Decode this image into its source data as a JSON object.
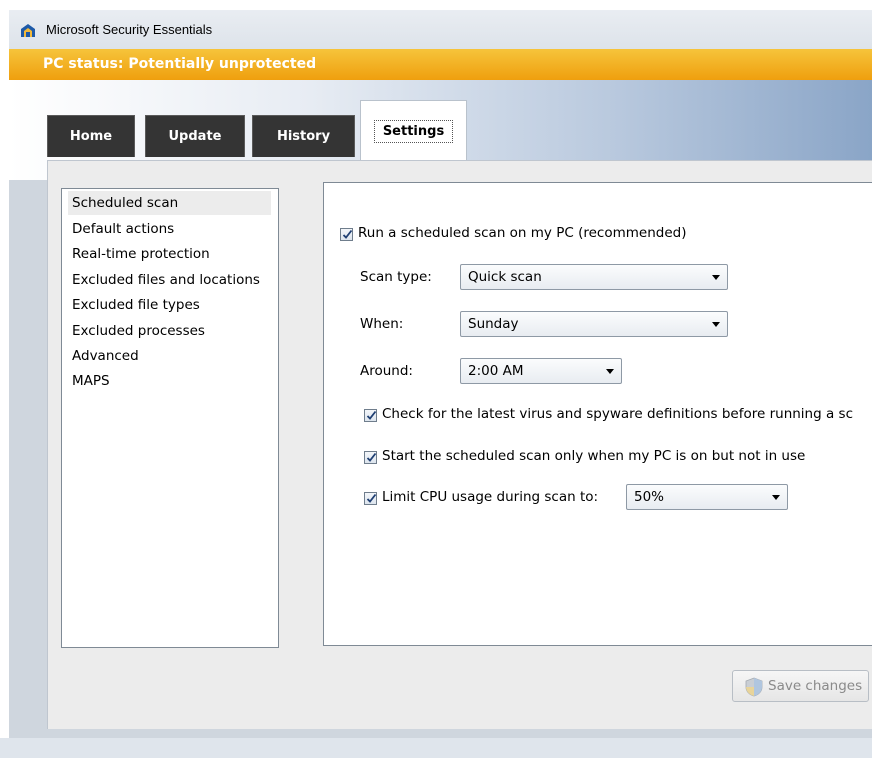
{
  "window": {
    "title": "Microsoft Security Essentials",
    "status": "PC status: Potentially unprotected",
    "status_color": "#f0a81a"
  },
  "tabs": [
    {
      "label": "Home"
    },
    {
      "label": "Update"
    },
    {
      "label": "History"
    },
    {
      "label": "Settings",
      "selected": true
    }
  ],
  "sidebar": {
    "items": [
      {
        "label": "Scheduled scan",
        "selected": true
      },
      {
        "label": "Default actions"
      },
      {
        "label": "Real-time protection"
      },
      {
        "label": "Excluded files and locations"
      },
      {
        "label": "Excluded file types"
      },
      {
        "label": "Excluded processes"
      },
      {
        "label": "Advanced"
      },
      {
        "label": "MAPS"
      }
    ]
  },
  "settings": {
    "run_scheduled": {
      "label": "Run a scheduled scan on my PC (recommended)",
      "checked": true
    },
    "scan_type": {
      "label": "Scan type:",
      "value": "Quick scan"
    },
    "when": {
      "label": "When:",
      "value": "Sunday"
    },
    "around": {
      "label": "Around:",
      "value": "2:00 AM"
    },
    "check_definitions": {
      "label": "Check for the latest virus and spyware definitions before running a sc",
      "checked": true
    },
    "only_idle": {
      "label": "Start the scheduled scan only when my PC is on but not in use",
      "checked": true
    },
    "limit_cpu": {
      "label": "Limit CPU usage during scan to:",
      "checked": true,
      "value": "50%"
    }
  },
  "footer": {
    "save_label": "Save changes",
    "save_icon": "shield-icon"
  }
}
